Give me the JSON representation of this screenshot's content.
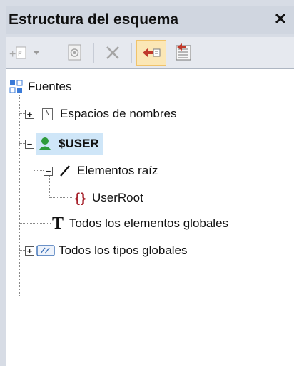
{
  "window": {
    "title": "Estructura del esquema",
    "close_label": "✕"
  },
  "toolbar": {
    "items": [
      {
        "icon": "add-element-dropdown-icon"
      },
      {
        "icon": "schema-file-icon"
      },
      {
        "icon": "delete-icon"
      },
      {
        "icon": "synchronize-tree-icon"
      },
      {
        "icon": "properties-list-icon"
      }
    ]
  },
  "tree": {
    "root": "Fuentes",
    "namespaces": "Espacios de nombres",
    "user": "$USER",
    "root_elements": "Elementos raíz",
    "user_root": "UserRoot",
    "global_elements": "Todos los elementos globales",
    "global_types": "Todos los tipos globales",
    "namespace_icon_letter": "N",
    "text_icon_letter": "T",
    "element_icon_glyph": "{}"
  },
  "colors": {
    "selection": "#cfe6f8",
    "title_bg": "#d0d6e0",
    "accent_red": "#c0392b",
    "user_green": "#2e9b3a"
  }
}
